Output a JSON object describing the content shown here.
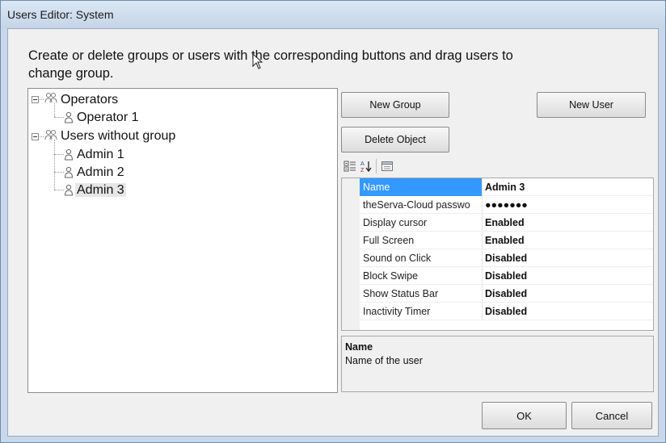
{
  "window": {
    "title": "Users Editor: System"
  },
  "instructions": "Create or delete groups or users with the corresponding buttons and drag users to change group.",
  "tree": {
    "groups": [
      {
        "label": "Operators",
        "users": [
          "Operator 1"
        ]
      },
      {
        "label": "Users without group",
        "users": [
          "Admin 1",
          "Admin 2",
          "Admin 3"
        ]
      }
    ],
    "selected_user": "Admin 3"
  },
  "buttons": {
    "new_group": "New Group",
    "new_user": "New User",
    "delete_object": "Delete Object",
    "ok": "OK",
    "cancel": "Cancel"
  },
  "toolbar": {
    "icons": [
      "categorized-icon",
      "alphabetical-sort-icon",
      "property-pages-icon"
    ]
  },
  "properties": [
    {
      "name": "Name",
      "value": "Admin 3"
    },
    {
      "name": "theServa-Cloud passwo",
      "value": "●●●●●●●"
    },
    {
      "name": "Display cursor",
      "value": "Enabled"
    },
    {
      "name": "Full Screen",
      "value": "Enabled"
    },
    {
      "name": "Sound on Click",
      "value": "Disabled"
    },
    {
      "name": "Block Swipe",
      "value": "Disabled"
    },
    {
      "name": "Show Status Bar",
      "value": "Disabled"
    },
    {
      "name": "Inactivity Timer",
      "value": "Disabled"
    }
  ],
  "description": {
    "title": "Name",
    "text": "Name of the user"
  },
  "colors": {
    "selection": "#3399ff",
    "title_bar": "#c4d5e8"
  }
}
